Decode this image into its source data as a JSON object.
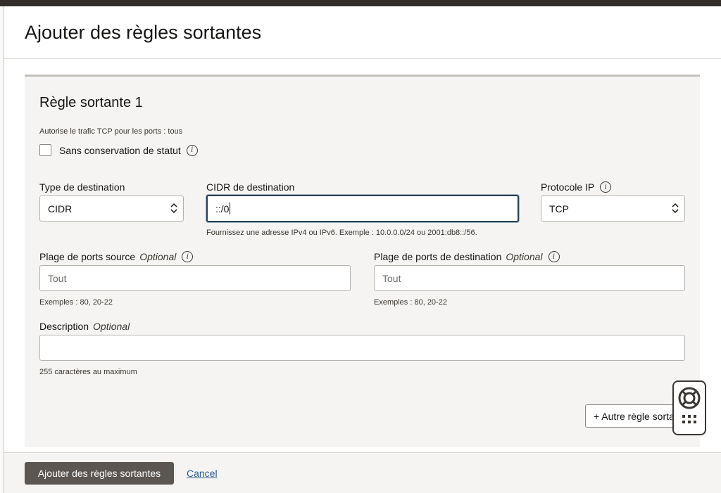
{
  "dialog": {
    "title": "Ajouter des règles sortantes"
  },
  "rule": {
    "title": "Règle sortante 1",
    "summary": "Autorise le trafic TCP pour les ports : tous",
    "stateless_label": "Sans conservation de statut",
    "dest_type": {
      "label": "Type de destination",
      "value": "CIDR"
    },
    "dest_cidr": {
      "label": "CIDR de destination",
      "value": "::/0",
      "help": "Fournissez une adresse IPv4 ou IPv6. Exemple : 10.0.0.0/24 ou 2001:db8::/56."
    },
    "protocol": {
      "label": "Protocole IP",
      "value": "TCP"
    },
    "source_ports": {
      "label": "Plage de ports source",
      "optional": "Optional",
      "placeholder": "Tout",
      "help": "Exemples : 80, 20-22"
    },
    "dest_ports": {
      "label": "Plage de ports de destination",
      "optional": "Optional",
      "placeholder": "Tout",
      "help": "Exemples : 80, 20-22"
    },
    "description": {
      "label": "Description",
      "optional": "Optional",
      "value": "",
      "help": "255 caractères au maximum"
    }
  },
  "add_another_label": "+ Autre règle sortante",
  "footer": {
    "submit_label": "Ajouter des règles sortantes",
    "cancel_label": "Cancel"
  },
  "colors": {
    "primary_button": "#5b5652",
    "link": "#2d5b8c",
    "focus_border": "#2b3f51"
  }
}
